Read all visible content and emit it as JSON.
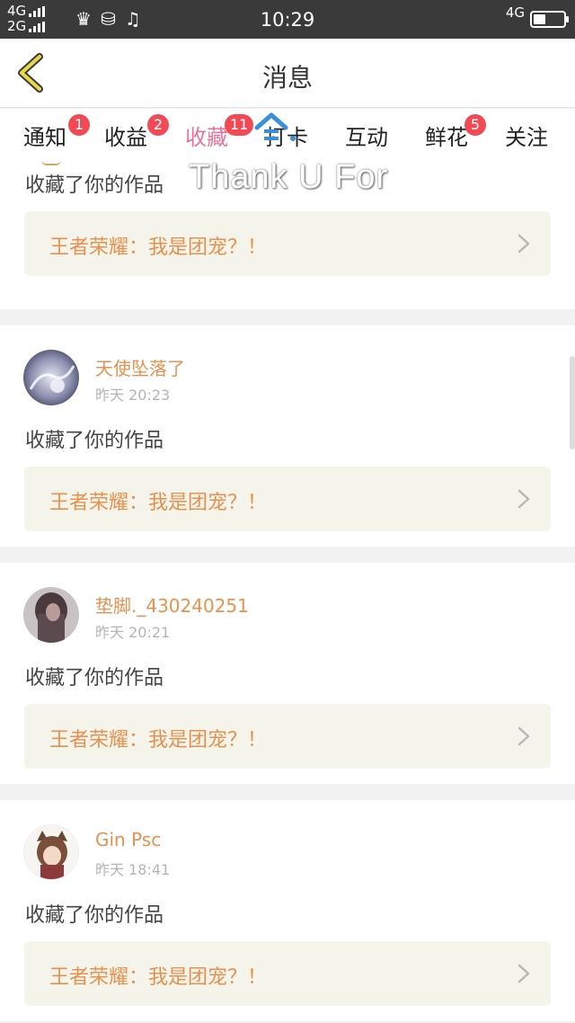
{
  "status_bar": {
    "net1": "4G",
    "net2": "2G",
    "time": "10:29",
    "net_right": "4G",
    "battery_level": 0.4,
    "icons": [
      "crown-icon",
      "database-icon",
      "music-note-icon"
    ]
  },
  "header": {
    "title": "消息"
  },
  "tabs": [
    {
      "label": "通知",
      "badge": "1"
    },
    {
      "label": "收益",
      "badge": "2"
    },
    {
      "label": "收藏",
      "badge": "11"
    },
    {
      "label": "打卡",
      "badge": ""
    },
    {
      "label": "互动",
      "badge": ""
    },
    {
      "label": "鲜花",
      "badge": "5"
    },
    {
      "label": "关注",
      "badge": ""
    }
  ],
  "active_tab": "收藏",
  "watermark": "Thank U For",
  "colors": {
    "accent_pink": "#e8739a",
    "badge_red": "#f24a54",
    "username_orange": "#e8914f",
    "box_bg": "#f5f4ea"
  },
  "notifications": [
    {
      "username": "",
      "time": "",
      "action": "收藏了你的作品",
      "work_title": "王者荣耀：我是团宠？！"
    },
    {
      "username": "天使坠落了",
      "time": "昨天 20:23",
      "action": "收藏了你的作品",
      "work_title": "王者荣耀：我是团宠？！"
    },
    {
      "username": "垫脚._430240251",
      "time": "昨天 20:21",
      "action": "收藏了你的作品",
      "work_title": "王者荣耀：我是团宠？！"
    },
    {
      "username": "Gin Psc",
      "time": "昨天 18:41",
      "action": "收藏了你的作品",
      "work_title": "王者荣耀：我是团宠？！"
    }
  ]
}
